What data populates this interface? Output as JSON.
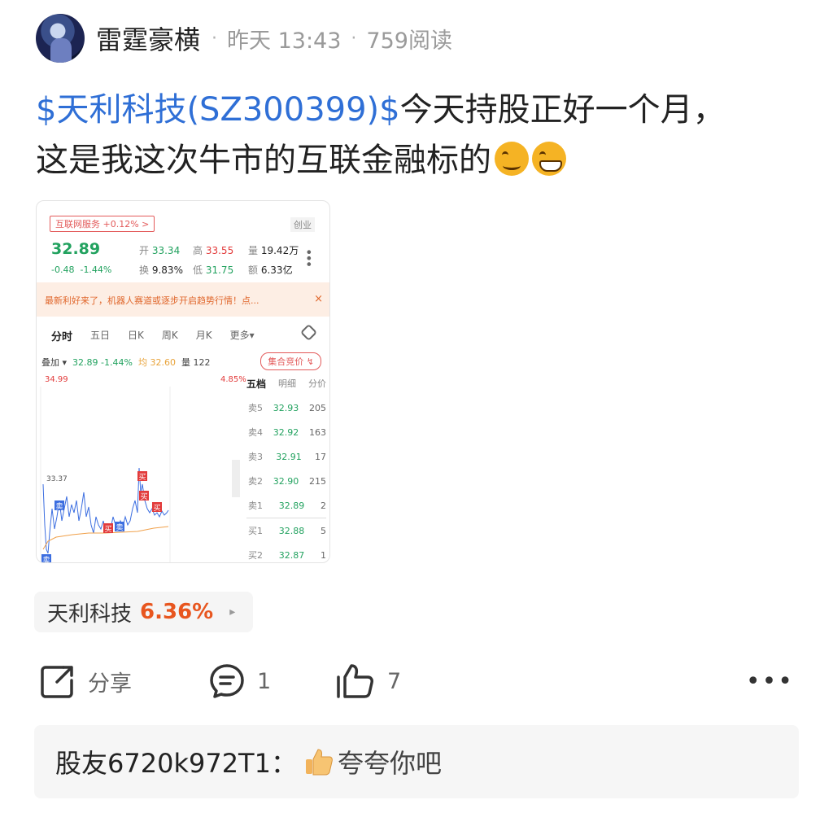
{
  "post": {
    "author": "雷霆豪横",
    "time": "昨天 13:43",
    "reads": "759阅读",
    "stock_link": "$天利科技(SZ300399)$",
    "text_line1": "今天持股正好一个月，",
    "text_line2": "这是我这次牛市的互联金融标的",
    "emojis": [
      "smirk-face-icon",
      "grin-face-icon"
    ]
  },
  "screenshot": {
    "sector_tag": "互联网服务 +0.12% >",
    "board": "创业",
    "price": "32.89",
    "change": "-0.48",
    "change_pct": "-1.44%",
    "open_label": "开",
    "open": "33.34",
    "high_label": "高",
    "high": "33.55",
    "vol_label": "量",
    "vol": "19.42万",
    "turnover_label": "换",
    "turnover": "9.83%",
    "low_label": "低",
    "low": "31.75",
    "amount_label": "额",
    "amount": "6.33亿",
    "notice": "最新利好来了，机器人赛道或逐步开启趋势行情！点...",
    "notice_close": "×",
    "tabs": [
      "分时",
      "五日",
      "日K",
      "周K",
      "月K",
      "更多▾"
    ],
    "overlay_label": "叠加 ▾",
    "overlay_price": "32.89",
    "overlay_pct": "-1.44%",
    "avg_label": "均 32.60",
    "qty_label": "量 122",
    "auction": "集合竞价 ↯",
    "chart_high": "34.99",
    "chart_high_pct": "4.85%",
    "chart_mark": "33.37",
    "book_tabs": [
      "五档",
      "明细",
      "分价"
    ],
    "sell": [
      {
        "label": "卖5",
        "price": "32.93",
        "vol": "205"
      },
      {
        "label": "卖4",
        "price": "32.92",
        "vol": "163"
      },
      {
        "label": "卖3",
        "price": "32.91",
        "vol": "17"
      },
      {
        "label": "卖2",
        "price": "32.90",
        "vol": "215"
      },
      {
        "label": "卖1",
        "price": "32.89",
        "vol": "2"
      }
    ],
    "buy": [
      {
        "label": "买1",
        "price": "32.88",
        "vol": "5"
      },
      {
        "label": "买2",
        "price": "32.87",
        "vol": "1"
      }
    ],
    "sell_marker": "卖",
    "buy_marker": "买"
  },
  "stock_chip": {
    "name": "天利科技",
    "pct": "6.36%",
    "arrow": "▸"
  },
  "actions": {
    "share": "分享",
    "comments": "1",
    "likes": "7",
    "more": "•••"
  },
  "comment": {
    "user": "股友6720k972T1：",
    "text": "夸夸你吧"
  },
  "colors": {
    "link": "#2f6fd6",
    "up": "#e8561f",
    "green": "#22a25f",
    "red": "#e23b3b"
  }
}
